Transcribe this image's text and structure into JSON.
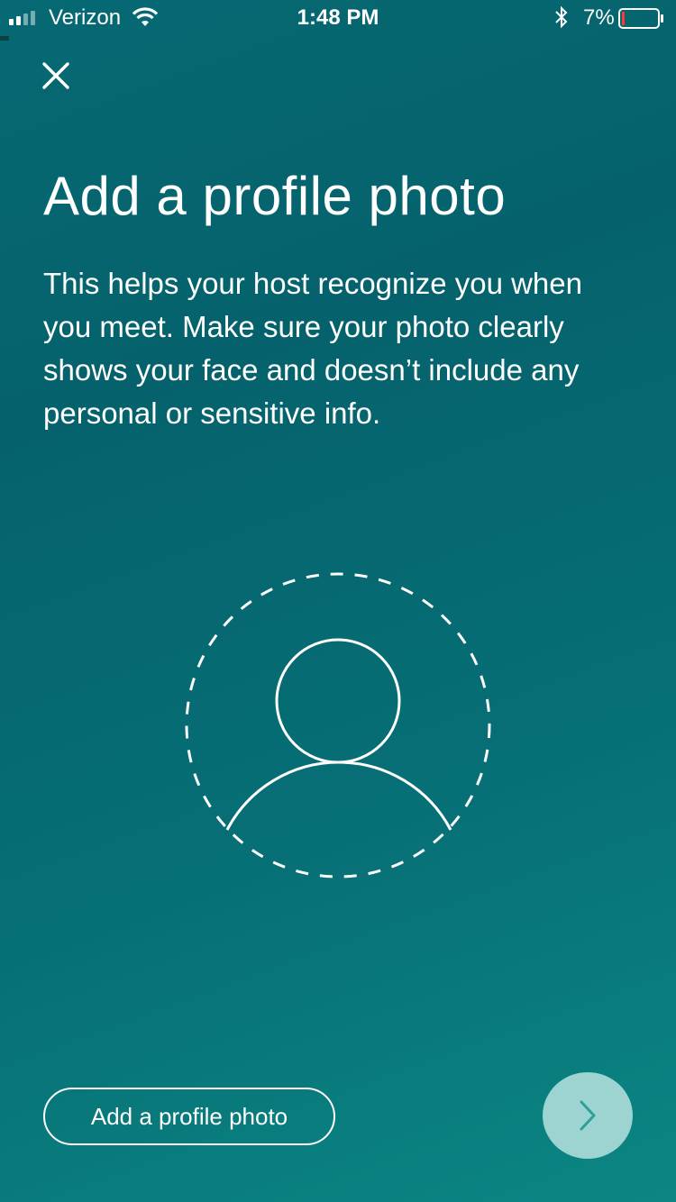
{
  "status_bar": {
    "carrier": "Verizon",
    "time": "1:48 PM",
    "battery_percent": "7%",
    "battery_level": 0.07,
    "battery_color": "#ff3b30"
  },
  "screen": {
    "title": "Add a profile photo",
    "description": "This helps your host recognize you when you meet. Make sure your photo clearly shows your face and doesn’t include any personal or sensitive info."
  },
  "actions": {
    "add_photo_label": "Add a profile photo",
    "next_icon": "chevron-right-icon",
    "close_icon": "close-icon"
  },
  "colors": {
    "background": "#066973",
    "next_button": "#9dd4d1",
    "next_chevron": "#2e9e9a"
  }
}
